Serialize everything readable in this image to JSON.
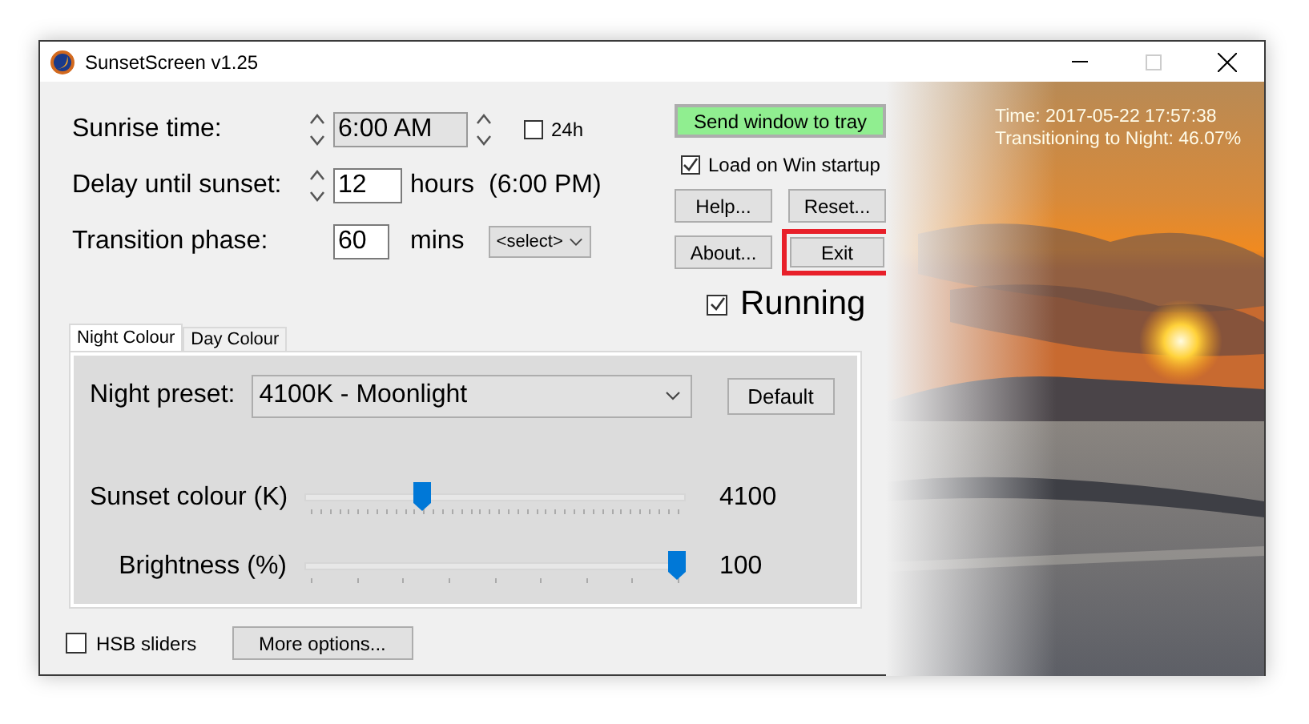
{
  "window": {
    "title": "SunsetScreen v1.25"
  },
  "sunrise": {
    "label": "Sunrise time:",
    "value": "6:00 AM",
    "option_label": "24h",
    "option_checked": false
  },
  "delay": {
    "label": "Delay until sunset:",
    "value": "12",
    "unit": "hours",
    "note": "(6:00 PM)"
  },
  "transition": {
    "label": "Transition phase:",
    "value": "60",
    "unit": "mins",
    "select_value": "<select>"
  },
  "actions": {
    "tray_button": "Send window to tray",
    "startup": {
      "label": "Load on Win startup",
      "checked": true
    },
    "buttons": [
      {
        "label": "Help...",
        "highlighted": false
      },
      {
        "label": "Reset...",
        "highlighted": false
      },
      {
        "label": "About...",
        "highlighted": false
      },
      {
        "label": "Exit",
        "highlighted": true
      }
    ],
    "running": {
      "label": "Running",
      "checked": true
    }
  },
  "tabs": [
    {
      "label": "Night Colour",
      "selected": true
    },
    {
      "label": "Day Colour",
      "selected": false
    }
  ],
  "preset": {
    "label": "Night preset:",
    "value": "4100K - Moonlight",
    "button": "Default"
  },
  "sliders": [
    {
      "label": "Sunset colour (K)",
      "level": 0.3,
      "reading": "4100"
    },
    {
      "label": "Brightness (%)",
      "level": 1,
      "reading": "100"
    }
  ],
  "footer": {
    "hsb": {
      "label": "HSB sliders",
      "checked": false
    },
    "button": "More options..."
  },
  "status": {
    "time": "Time: 2017-05-22 17:57:38",
    "progress": "Transitioning to Night: 46.07%"
  }
}
